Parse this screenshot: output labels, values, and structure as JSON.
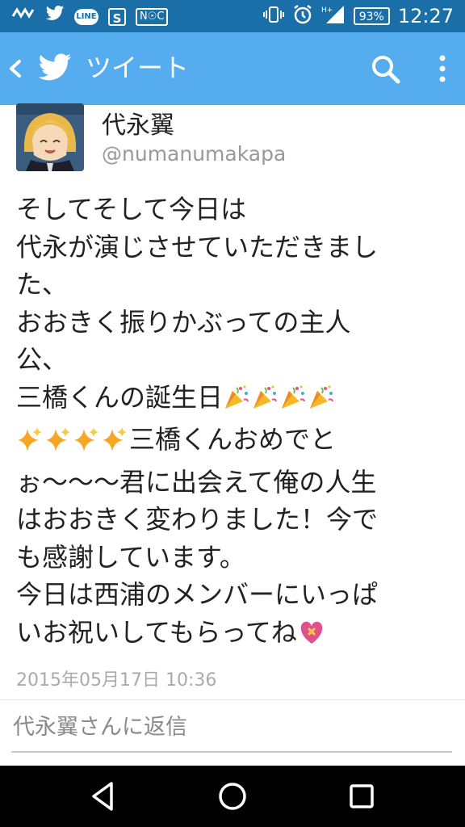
{
  "status_bar": {
    "battery": "93%",
    "time": "12:27",
    "left_icons": [
      "wave-icon",
      "twitter-bird-icon",
      "line-app-icon",
      "s-app-icon",
      "nfc-icon"
    ],
    "line_label": "LINE",
    "s_label": "S",
    "nfc_label": "N☉C",
    "right_icons": [
      "vibrate-icon",
      "alarm-icon",
      "signal-icon",
      "battery-icon"
    ]
  },
  "app_bar": {
    "title": "ツイート",
    "background_color": "#55acee"
  },
  "tweet": {
    "author_name": "代永翼",
    "author_handle": "@numanumakapa",
    "lines": [
      "そしてそして今日は",
      "代永が演じさせていただきまし",
      "た、",
      "おおきく振りかぶっての主人",
      "公、",
      "三橋くんの誕生日",
      "三橋くんおめでと",
      "ぉ〜〜〜君に出会えて俺の人生",
      "はおおきく変わりました！今で",
      "も感謝しています。",
      "今日は西浦のメンバーにいっぱ",
      "いお祝いしてもらってね"
    ],
    "emoji": {
      "party": "party-popper-icon",
      "sparkle": "sparkles-icon",
      "heart": "heart-ribbon-icon"
    },
    "timestamp": "2015年05月17日 10:36"
  },
  "reply": {
    "placeholder": "代永翼さんに返信"
  },
  "colors": {
    "status_bar": "#1b6fa8",
    "accent": "#55acee",
    "timestamp": "#aaaaaa"
  }
}
